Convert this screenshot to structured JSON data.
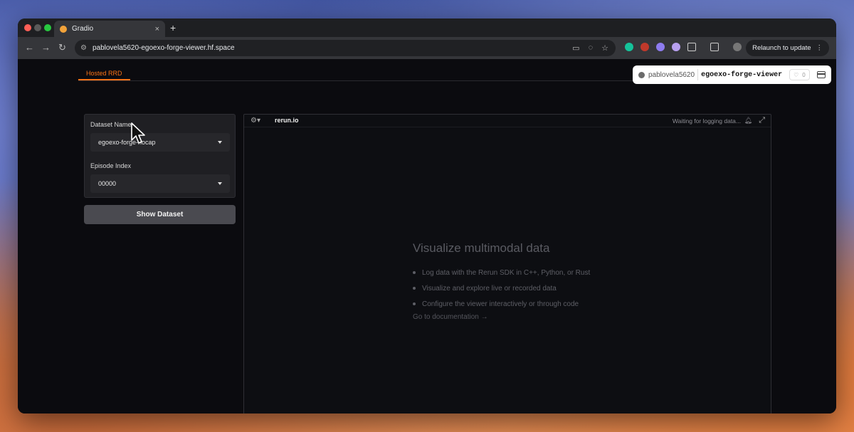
{
  "browser": {
    "tab_title": "Gradio",
    "tab_close": "×",
    "new_tab": "+",
    "url": "pablovela5620-egoexo-forge-viewer.hf.space",
    "relaunch_label": "Relaunch to update",
    "relaunch_menu": "⋮"
  },
  "page": {
    "tab_label": "Hosted RRD"
  },
  "hf_badge": {
    "user": "pablovela5620",
    "repo": "egoexo-forge-viewer",
    "likes": "0"
  },
  "form": {
    "dataset_label": "Dataset Name",
    "dataset_value": "egoexo-forge-hocap",
    "episode_label": "Episode Index",
    "episode_value": "00000",
    "show_button": "Show Dataset"
  },
  "viewer": {
    "brand": "rerun.io",
    "status": "Waiting for logging data...",
    "welcome_title": "Visualize multimodal data",
    "bullets": [
      "Log data with the Rerun SDK in C++, Python, or Rust",
      "Visualize and explore live or recorded data",
      "Configure the viewer interactively or through code"
    ],
    "doc_link": "Go to documentation →"
  },
  "colors": {
    "accent": "#f97316",
    "button": "#4a4a50"
  }
}
